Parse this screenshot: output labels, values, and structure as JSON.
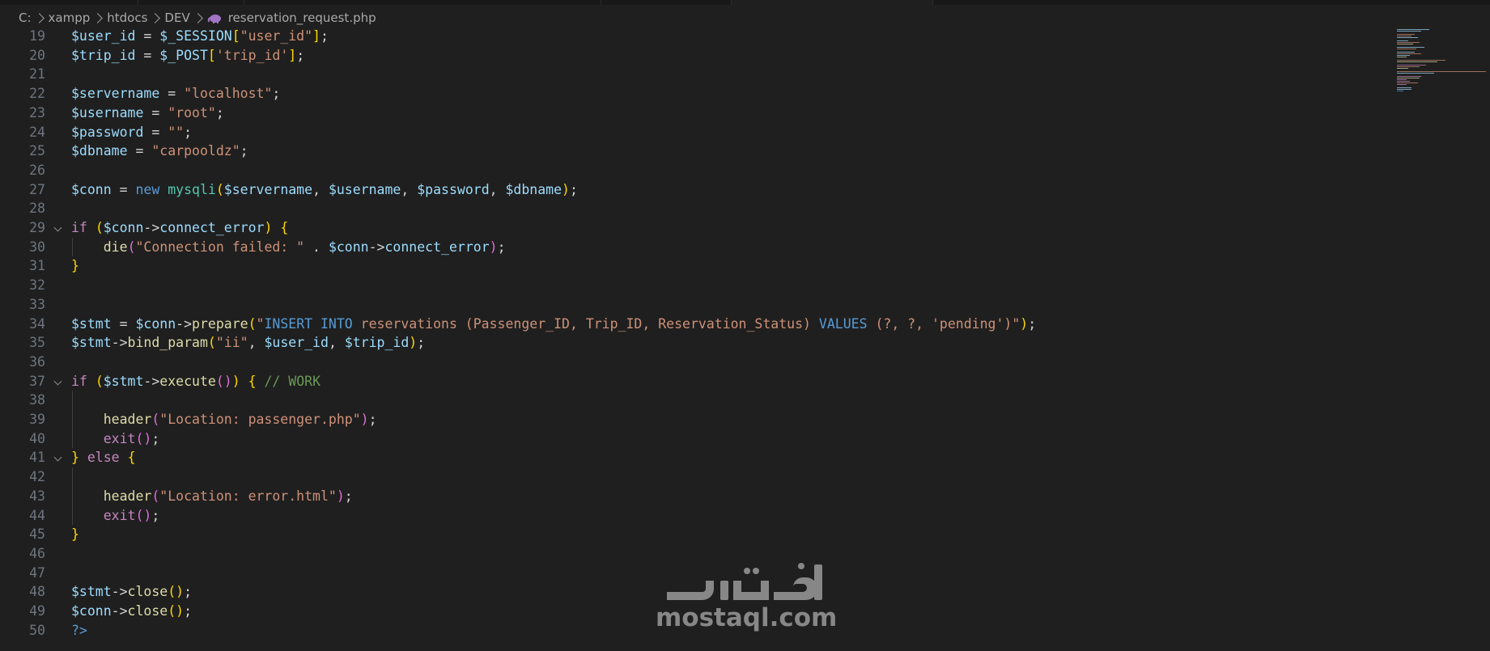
{
  "breadcrumb": {
    "items": [
      "C:",
      "xampp",
      "htdocs",
      "DEV"
    ],
    "file": "reservation_request.php"
  },
  "editor": {
    "lines": [
      {
        "n": "19",
        "tokens": [
          [
            "var",
            "$user_id"
          ],
          [
            "op",
            " = "
          ],
          [
            "var",
            "$_SESSION"
          ],
          [
            "p1",
            "["
          ],
          [
            "str",
            "\"user_id\""
          ],
          [
            "p1",
            "]"
          ],
          [
            "op",
            ";"
          ]
        ]
      },
      {
        "n": "20",
        "tokens": [
          [
            "var",
            "$trip_id"
          ],
          [
            "op",
            " = "
          ],
          [
            "var",
            "$_POST"
          ],
          [
            "p1",
            "["
          ],
          [
            "str",
            "'trip_id'"
          ],
          [
            "p1",
            "]"
          ],
          [
            "op",
            ";"
          ]
        ]
      },
      {
        "n": "21",
        "tokens": []
      },
      {
        "n": "22",
        "tokens": [
          [
            "var",
            "$servername"
          ],
          [
            "op",
            " = "
          ],
          [
            "str",
            "\"localhost\""
          ],
          [
            "op",
            ";"
          ]
        ]
      },
      {
        "n": "23",
        "tokens": [
          [
            "var",
            "$username"
          ],
          [
            "op",
            " = "
          ],
          [
            "str",
            "\"root\""
          ],
          [
            "op",
            ";"
          ]
        ]
      },
      {
        "n": "24",
        "tokens": [
          [
            "var",
            "$password"
          ],
          [
            "op",
            " = "
          ],
          [
            "str",
            "\"\""
          ],
          [
            "op",
            ";"
          ]
        ]
      },
      {
        "n": "25",
        "tokens": [
          [
            "var",
            "$dbname"
          ],
          [
            "op",
            " = "
          ],
          [
            "str",
            "\"carpooldz\""
          ],
          [
            "op",
            ";"
          ]
        ]
      },
      {
        "n": "26",
        "tokens": []
      },
      {
        "n": "27",
        "tokens": [
          [
            "var",
            "$conn"
          ],
          [
            "op",
            " = "
          ],
          [
            "dec",
            "new"
          ],
          [
            "op",
            " "
          ],
          [
            "cls",
            "mysqli"
          ],
          [
            "p1",
            "("
          ],
          [
            "var",
            "$servername"
          ],
          [
            "op",
            ", "
          ],
          [
            "var",
            "$username"
          ],
          [
            "op",
            ", "
          ],
          [
            "var",
            "$password"
          ],
          [
            "op",
            ", "
          ],
          [
            "var",
            "$dbname"
          ],
          [
            "p1",
            ")"
          ],
          [
            "op",
            ";"
          ]
        ]
      },
      {
        "n": "28",
        "tokens": []
      },
      {
        "n": "29",
        "fold": true,
        "tokens": [
          [
            "kw",
            "if"
          ],
          [
            "op",
            " "
          ],
          [
            "p1",
            "("
          ],
          [
            "var",
            "$conn"
          ],
          [
            "op",
            "->"
          ],
          [
            "var",
            "connect_error"
          ],
          [
            "p1",
            ")"
          ],
          [
            "op",
            " "
          ],
          [
            "p1",
            "{"
          ]
        ]
      },
      {
        "n": "30",
        "tokens": [
          [
            "op",
            "    "
          ],
          [
            "fn",
            "die"
          ],
          [
            "p2",
            "("
          ],
          [
            "str",
            "\"Connection failed: \""
          ],
          [
            "op",
            " . "
          ],
          [
            "var",
            "$conn"
          ],
          [
            "op",
            "->"
          ],
          [
            "var",
            "connect_error"
          ],
          [
            "p2",
            ")"
          ],
          [
            "op",
            ";"
          ]
        ]
      },
      {
        "n": "31",
        "tokens": [
          [
            "p1",
            "}"
          ]
        ]
      },
      {
        "n": "32",
        "tokens": []
      },
      {
        "n": "33",
        "tokens": []
      },
      {
        "n": "34",
        "tokens": [
          [
            "var",
            "$stmt"
          ],
          [
            "op",
            " = "
          ],
          [
            "var",
            "$conn"
          ],
          [
            "op",
            "->"
          ],
          [
            "fn",
            "prepare"
          ],
          [
            "p1",
            "("
          ],
          [
            "str",
            "\""
          ],
          [
            "dec",
            "INSERT INTO"
          ],
          [
            "str",
            " reservations (Passenger_ID, Trip_ID, Reservation_Status) "
          ],
          [
            "dec",
            "VALUES"
          ],
          [
            "str",
            " (?, ?, 'pending')\""
          ],
          [
            "p1",
            ")"
          ],
          [
            "op",
            ";"
          ]
        ]
      },
      {
        "n": "35",
        "tokens": [
          [
            "var",
            "$stmt"
          ],
          [
            "op",
            "->"
          ],
          [
            "fn",
            "bind_param"
          ],
          [
            "p1",
            "("
          ],
          [
            "str",
            "\"ii\""
          ],
          [
            "op",
            ", "
          ],
          [
            "var",
            "$user_id"
          ],
          [
            "op",
            ", "
          ],
          [
            "var",
            "$trip_id"
          ],
          [
            "p1",
            ")"
          ],
          [
            "op",
            ";"
          ]
        ]
      },
      {
        "n": "36",
        "tokens": []
      },
      {
        "n": "37",
        "fold": true,
        "tokens": [
          [
            "kw",
            "if"
          ],
          [
            "op",
            " "
          ],
          [
            "p1",
            "("
          ],
          [
            "var",
            "$stmt"
          ],
          [
            "op",
            "->"
          ],
          [
            "fn",
            "execute"
          ],
          [
            "p2",
            "()"
          ],
          [
            "p1",
            ")"
          ],
          [
            "op",
            " "
          ],
          [
            "p1",
            "{"
          ],
          [
            "op",
            " "
          ],
          [
            "cmt",
            "// WORK"
          ]
        ]
      },
      {
        "n": "38",
        "tokens": []
      },
      {
        "n": "39",
        "tokens": [
          [
            "op",
            "    "
          ],
          [
            "fn",
            "header"
          ],
          [
            "p2",
            "("
          ],
          [
            "str",
            "\"Location: passenger.php\""
          ],
          [
            "p2",
            ")"
          ],
          [
            "op",
            ";"
          ]
        ]
      },
      {
        "n": "40",
        "tokens": [
          [
            "op",
            "    "
          ],
          [
            "kw",
            "exit"
          ],
          [
            "p2",
            "()"
          ],
          [
            "op",
            ";"
          ]
        ]
      },
      {
        "n": "41",
        "fold": true,
        "tokens": [
          [
            "p1",
            "}"
          ],
          [
            "op",
            " "
          ],
          [
            "kw",
            "else"
          ],
          [
            "op",
            " "
          ],
          [
            "p1",
            "{"
          ]
        ]
      },
      {
        "n": "42",
        "tokens": []
      },
      {
        "n": "43",
        "tokens": [
          [
            "op",
            "    "
          ],
          [
            "fn",
            "header"
          ],
          [
            "p2",
            "("
          ],
          [
            "str",
            "\"Location: error.html\""
          ],
          [
            "p2",
            ")"
          ],
          [
            "op",
            ";"
          ]
        ]
      },
      {
        "n": "44",
        "tokens": [
          [
            "op",
            "    "
          ],
          [
            "kw",
            "exit"
          ],
          [
            "p2",
            "()"
          ],
          [
            "op",
            ";"
          ]
        ]
      },
      {
        "n": "45",
        "tokens": [
          [
            "p1",
            "}"
          ]
        ]
      },
      {
        "n": "46",
        "tokens": []
      },
      {
        "n": "47",
        "tokens": []
      },
      {
        "n": "48",
        "tokens": [
          [
            "var",
            "$stmt"
          ],
          [
            "op",
            "->"
          ],
          [
            "fn",
            "close"
          ],
          [
            "p1",
            "()"
          ],
          [
            "op",
            ";"
          ]
        ]
      },
      {
        "n": "49",
        "tokens": [
          [
            "var",
            "$conn"
          ],
          [
            "op",
            "->"
          ],
          [
            "fn",
            "close"
          ],
          [
            "p1",
            "()"
          ],
          [
            "op",
            ";"
          ]
        ]
      },
      {
        "n": "50",
        "tokens": [
          [
            "dec",
            "?>"
          ]
        ]
      }
    ]
  },
  "colors": {
    "background": "#1f1f1f",
    "variable": "#9cdcfe",
    "string": "#ce9178",
    "keyword": "#c586c0",
    "function": "#dcdcaa",
    "declaration": "#569cd6",
    "class": "#4ec9b0",
    "comment": "#6a9955",
    "bracket1": "#ffd700",
    "bracket2": "#da70d6"
  },
  "watermark": {
    "arabic": "مستقل",
    "latin": "mostaql.com"
  }
}
